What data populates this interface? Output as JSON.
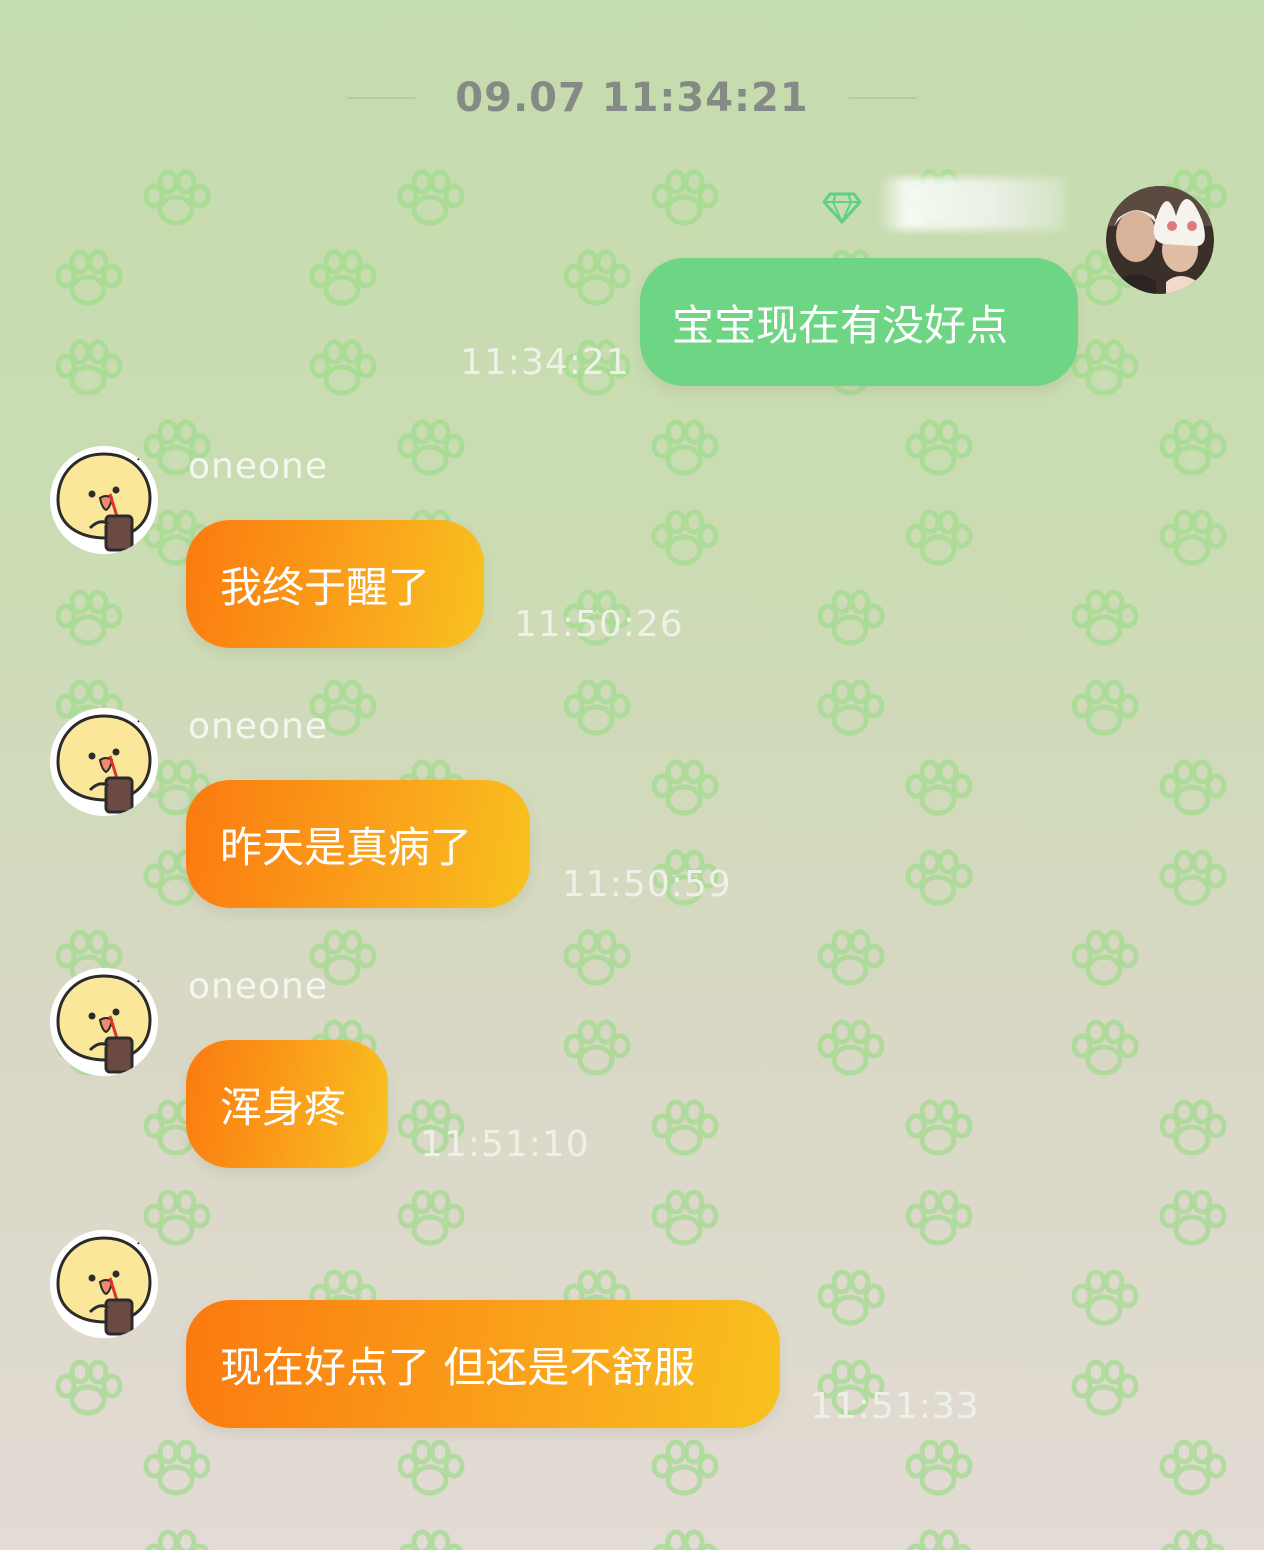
{
  "date_separator": "09.07 11:34:21",
  "colors": {
    "sent_bubble": "#6dd583",
    "received_bubble_start": "#fb7a0f",
    "received_bubble_end": "#f8c21f",
    "background_top": "#c5dcae",
    "background_bottom": "#e3dbd5"
  },
  "self": {
    "badge_icon": "diamond-icon",
    "avatar_icon": "user-photo-avatar"
  },
  "contact": {
    "name": "oneone",
    "avatar_icon": "chick-drinking-avatar"
  },
  "messages": [
    {
      "from": "self",
      "text": "宝宝现在有没好点",
      "time": "11:34:21"
    },
    {
      "from": "contact",
      "sender": "oneone",
      "text": "我终于醒了",
      "time": "11:50:26"
    },
    {
      "from": "contact",
      "sender": "oneone",
      "text": "昨天是真病了",
      "time": "11:50:59"
    },
    {
      "from": "contact",
      "sender": "oneone",
      "text": "浑身疼",
      "time": "11:51:10"
    },
    {
      "from": "contact",
      "text": "现在好点了 但还是不舒服",
      "time": "11:51:33"
    }
  ]
}
